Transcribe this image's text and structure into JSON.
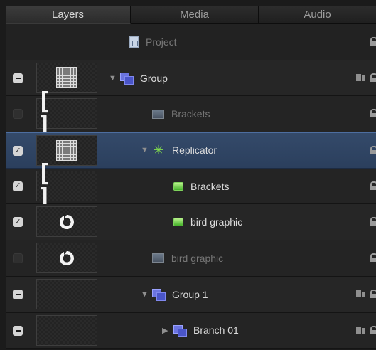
{
  "tabs": [
    {
      "label": "Layers",
      "active": true
    },
    {
      "label": "Media",
      "active": false
    },
    {
      "label": "Audio",
      "active": false
    }
  ],
  "layers": [
    {
      "name": "Project",
      "state": "none",
      "thumb": "none",
      "icon": "project-icon",
      "disclosure": "",
      "indent": 0,
      "dim": true
    },
    {
      "name": "Group",
      "state": "mixed",
      "thumb": "grid",
      "icon": "group-icon",
      "disclosure": "▼",
      "indent": 1,
      "dim": false,
      "underline": true,
      "mask": true
    },
    {
      "name": "Brackets",
      "state": "off",
      "thumb": "brackets",
      "icon": "image-icon",
      "disclosure": "",
      "indent": 2,
      "dim": true
    },
    {
      "name": "Replicator",
      "state": "checked",
      "thumb": "grid",
      "icon": "replicator-icon",
      "disclosure": "▼",
      "indent": 2,
      "dim": false,
      "selected": true
    },
    {
      "name": "Brackets",
      "state": "checked",
      "thumb": "brackets",
      "icon": "green-square-icon",
      "disclosure": "",
      "indent": 3,
      "dim": false
    },
    {
      "name": "bird graphic",
      "state": "checked",
      "thumb": "bird",
      "icon": "green-square-icon",
      "disclosure": "",
      "indent": 3,
      "dim": false
    },
    {
      "name": "bird graphic",
      "state": "off",
      "thumb": "bird",
      "icon": "image-icon",
      "disclosure": "",
      "indent": 2,
      "dim": true
    },
    {
      "name": "Group 1",
      "state": "mixed",
      "thumb": "empty",
      "icon": "group-icon",
      "disclosure": "▼",
      "indent": 2,
      "dim": false,
      "mask": true
    },
    {
      "name": "Branch 01",
      "state": "mixed",
      "thumb": "empty",
      "icon": "group-icon",
      "disclosure": "▶",
      "indent": 3,
      "dim": false,
      "mask": true
    }
  ],
  "thumb_brackets_text": "[ ]"
}
